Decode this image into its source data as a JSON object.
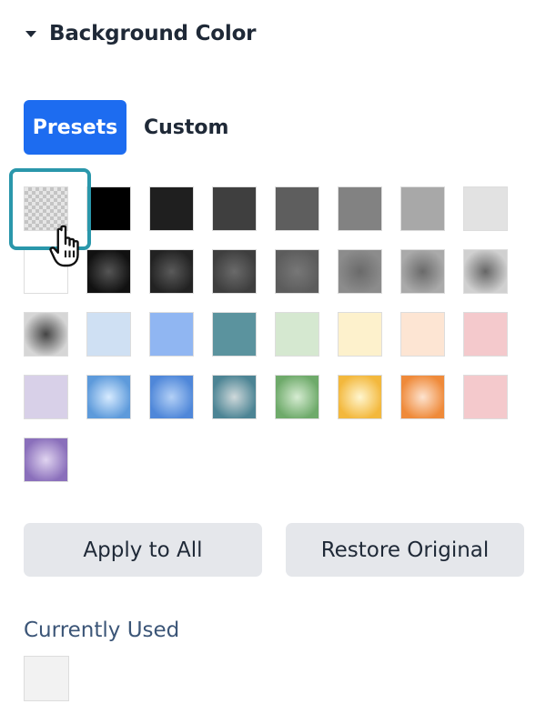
{
  "section": {
    "title": "Background Color",
    "caret_icon": "caret-down-icon"
  },
  "tabs": [
    {
      "label": "Presets",
      "active": true
    },
    {
      "label": "Custom",
      "active": false
    }
  ],
  "accent_color": "#1d6cf0",
  "selection_color": "#2a97ab",
  "presets": [
    {
      "kind": "transparent"
    },
    {
      "kind": "solid",
      "color": "#000000"
    },
    {
      "kind": "solid",
      "color": "#1f1f1f"
    },
    {
      "kind": "solid",
      "color": "#3f3f3f"
    },
    {
      "kind": "solid",
      "color": "#5e5e5e"
    },
    {
      "kind": "solid",
      "color": "#828282"
    },
    {
      "kind": "solid",
      "color": "#a8a8a8"
    },
    {
      "kind": "solid",
      "color": "#e2e2e2"
    },
    {
      "kind": "solid",
      "color": "#ffffff"
    },
    {
      "kind": "radial",
      "center": "#555555",
      "edge": "#111111"
    },
    {
      "kind": "radial",
      "center": "#5a5a5a",
      "edge": "#222222"
    },
    {
      "kind": "radial",
      "center": "#6a6a6a",
      "edge": "#3e3e3e"
    },
    {
      "kind": "radial",
      "center": "#777777",
      "edge": "#5c5c5c"
    },
    {
      "kind": "radial",
      "center": "#6a6a6a",
      "edge": "#8c8c8c"
    },
    {
      "kind": "radial",
      "center": "#6a6a6a",
      "edge": "#aaaaaa"
    },
    {
      "kind": "radial",
      "center": "#666666",
      "edge": "#d0d0d0"
    },
    {
      "kind": "radial",
      "center": "#444444",
      "edge": "#d6d6d6"
    },
    {
      "kind": "solid",
      "color": "#cfe0f3"
    },
    {
      "kind": "solid",
      "color": "#90b6f2"
    },
    {
      "kind": "solid",
      "color": "#5b939e"
    },
    {
      "kind": "solid",
      "color": "#d5e8d0"
    },
    {
      "kind": "solid",
      "color": "#fdf1cc"
    },
    {
      "kind": "solid",
      "color": "#fde5d3"
    },
    {
      "kind": "solid",
      "color": "#f4c9cc"
    },
    {
      "kind": "solid",
      "color": "#d8d0e8"
    },
    {
      "kind": "radial",
      "center": "#d7ebff",
      "edge": "#5d9adb"
    },
    {
      "kind": "radial",
      "center": "#b3d0f6",
      "edge": "#4f87d9"
    },
    {
      "kind": "radial",
      "center": "#cfd9db",
      "edge": "#4c8494"
    },
    {
      "kind": "radial",
      "center": "#d6ecd2",
      "edge": "#6eaa6a"
    },
    {
      "kind": "radial",
      "center": "#fff6cf",
      "edge": "#f3b83d"
    },
    {
      "kind": "radial",
      "center": "#fde3cf",
      "edge": "#ef8a3a"
    },
    {
      "kind": "solid",
      "color": "#f4c9cc"
    },
    {
      "kind": "radial",
      "center": "#e0d4f0",
      "edge": "#8a6fbb"
    }
  ],
  "buttons": {
    "apply_all": "Apply to All",
    "restore": "Restore Original"
  },
  "currently_used": {
    "label": "Currently Used",
    "color": "#f2f2f2"
  },
  "cursor_icon": "hand-pointer-icon"
}
